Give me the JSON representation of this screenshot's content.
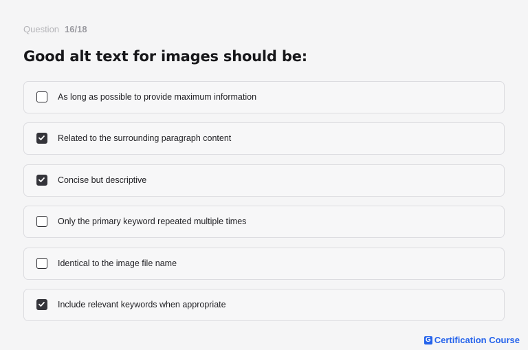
{
  "quiz": {
    "progress_label": "Question",
    "progress_value": "16/18",
    "question": "Good alt text for images should be:",
    "options": [
      {
        "label": "As long as possible to provide maximum information",
        "checked": false
      },
      {
        "label": "Related to the surrounding paragraph content",
        "checked": true
      },
      {
        "label": "Concise but descriptive",
        "checked": true
      },
      {
        "label": "Only the primary keyword repeated multiple times",
        "checked": false
      },
      {
        "label": "Identical to the image file name",
        "checked": false
      },
      {
        "label": "Include relevant keywords when appropriate",
        "checked": true
      }
    ]
  },
  "brand": {
    "logo_letter": "G",
    "name": "Certification Course"
  },
  "colors": {
    "accent": "#2563eb",
    "checked_fill": "#34343a"
  }
}
